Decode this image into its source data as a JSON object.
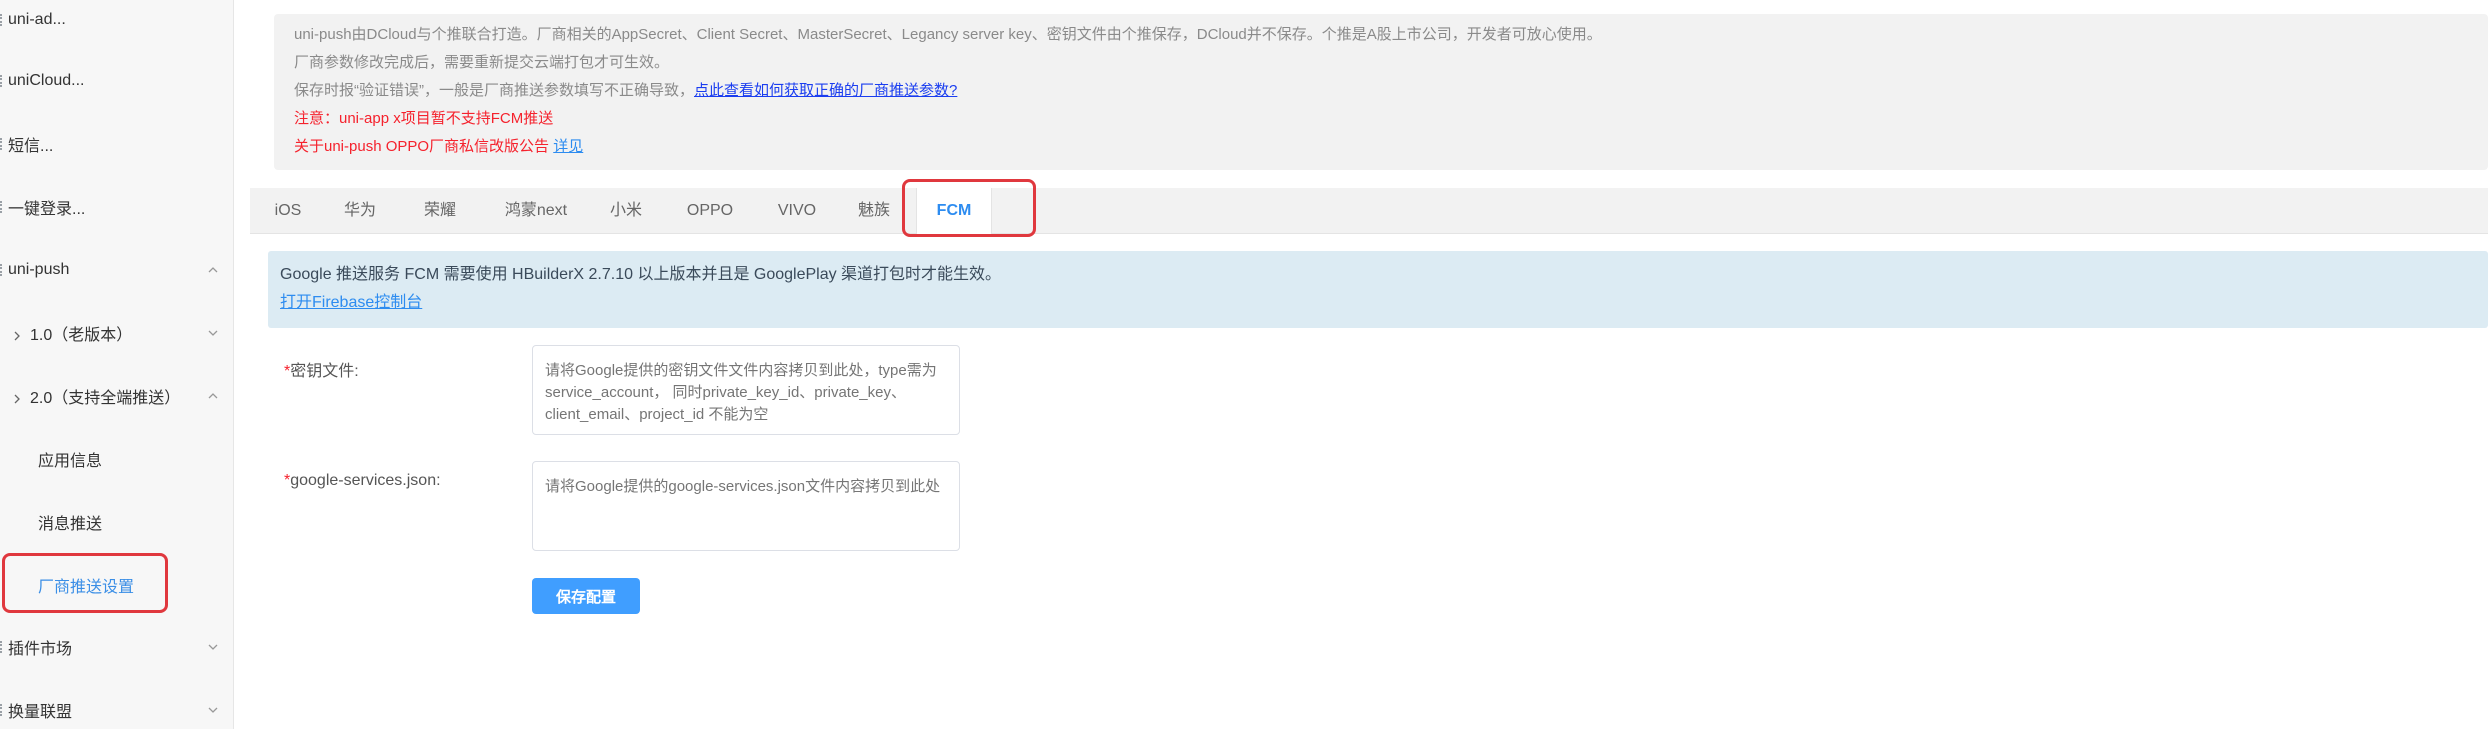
{
  "sidebar": {
    "items": [
      {
        "label": "uni-ad..."
      },
      {
        "label": "uniCloud..."
      },
      {
        "label": "短信..."
      },
      {
        "label": "一键登录..."
      },
      {
        "label": "uni-push"
      },
      {
        "label": "1.0（老版本）"
      },
      {
        "label": "2.0（支持全端推送）"
      },
      {
        "label": "应用信息"
      },
      {
        "label": "消息推送"
      },
      {
        "label": "厂商推送设置"
      },
      {
        "label": "插件市场"
      },
      {
        "label": "换量联盟"
      }
    ]
  },
  "notice": {
    "line1": "uni-push由DCloud与个推联合打造。厂商相关的AppSecret、Client Secret、MasterSecret、Legancy server key、密钥文件由个推保存，DCloud并不保存。个推是A股上市公司，开发者可放心使用。",
    "line2": "厂商参数修改完成后，需要重新提交云端打包才可生效。",
    "line3_prefix": "保存时报“验证错误”，一般是厂商推送参数填写不正确导致，",
    "line3_link": "点此查看如何获取正确的厂商推送参数?",
    "line4": "注意：uni-app x项目暂不支持FCM推送",
    "line5_prefix": "关于uni-push OPPO厂商私信改版公告",
    "line5_link": "详见"
  },
  "tabs": [
    "iOS",
    "华为",
    "荣耀",
    "鸿蒙next",
    "小米",
    "OPPO",
    "VIVO",
    "魅族",
    "FCM"
  ],
  "active_tab": "FCM",
  "info": {
    "text": "Google 推送服务 FCM 需要使用 HBuilderX 2.7.10 以上版本并且是 GooglePlay 渠道打包时才能生效。",
    "link": "打开Firebase控制台"
  },
  "form": {
    "key_file_label": "密钥文件:",
    "key_file_placeholder": "请将Google提供的密钥文件文件内容拷贝到此处，type需为service_account， 同时private_key_id、private_key、client_email、project_id 不能为空",
    "services_label": "google-services.json:",
    "services_placeholder": "请将Google提供的google-services.json文件内容拷贝到此处",
    "required_mark": "*",
    "save_label": "保存配置"
  },
  "colors": {
    "accent": "#409eff",
    "link": "#2d8cf0",
    "warning": "#f5222d",
    "highlight": "#e0383e"
  }
}
